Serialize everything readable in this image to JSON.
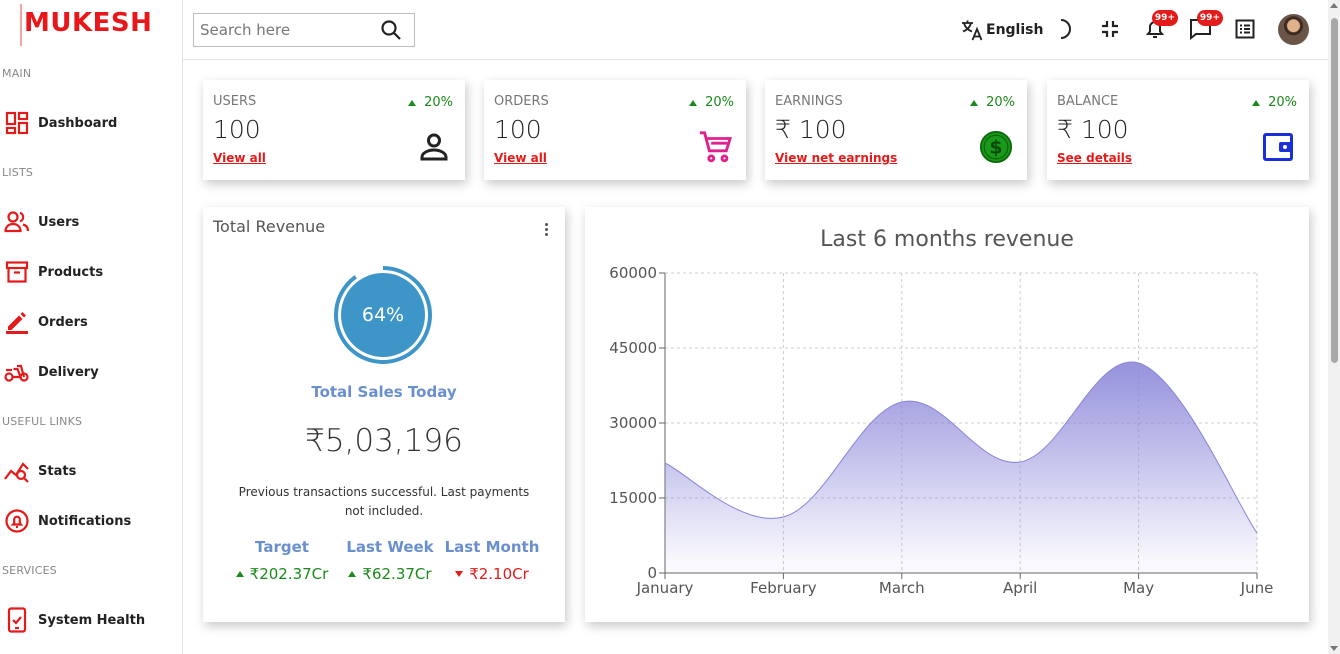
{
  "app": {
    "logo": "MUKESH"
  },
  "sidebar": {
    "sections": [
      {
        "title": "MAIN",
        "items": [
          {
            "label": "Dashboard",
            "icon": "dashboard-icon"
          }
        ]
      },
      {
        "title": "LISTS",
        "items": [
          {
            "label": "Users",
            "icon": "users-icon"
          },
          {
            "label": "Products",
            "icon": "products-icon"
          },
          {
            "label": "Orders",
            "icon": "orders-icon"
          },
          {
            "label": "Delivery",
            "icon": "delivery-icon"
          }
        ]
      },
      {
        "title": "USEFUL LINKS",
        "items": [
          {
            "label": "Stats",
            "icon": "stats-icon"
          },
          {
            "label": "Notifications",
            "icon": "notifications-icon"
          }
        ]
      },
      {
        "title": "SERVICES",
        "items": [
          {
            "label": "System Health",
            "icon": "system-health-icon"
          }
        ]
      }
    ]
  },
  "topbar": {
    "search_placeholder": "Search here",
    "language": "English",
    "notification_badge": "99+",
    "messages_badge": "99+"
  },
  "widgets": [
    {
      "title": "USERS",
      "value": "100",
      "link": "View all",
      "percent": "20%",
      "icon": "user-icon",
      "icon_color": "#222222"
    },
    {
      "title": "ORDERS",
      "value": "100",
      "link": "View all",
      "percent": "20%",
      "icon": "cart-icon",
      "icon_color": "#e0208f"
    },
    {
      "title": "EARNINGS",
      "value": "₹ 100",
      "link": "View net earnings",
      "percent": "20%",
      "icon": "dollar-icon",
      "icon_color": "#1a8a1a"
    },
    {
      "title": "BALANCE",
      "value": "₹ 100",
      "link": "See details",
      "percent": "20%",
      "icon": "wallet-icon",
      "icon_color": "#1a2fd6"
    }
  ],
  "revenue": {
    "title": "Total Revenue",
    "progress_percent": 64,
    "progress_label": "64%",
    "sales_label": "Total Sales Today",
    "amount": "₹5,03,196",
    "note": "Previous transactions successful. Last payments not included.",
    "kpis": [
      {
        "label": "Target",
        "value": "₹202.37Cr",
        "trend": "up"
      },
      {
        "label": "Last Week",
        "value": "₹62.37Cr",
        "trend": "up"
      },
      {
        "label": "Last Month",
        "value": "₹2.10Cr",
        "trend": "down"
      }
    ]
  },
  "chart_data": {
    "type": "area",
    "title": "Last 6 months revenue",
    "categories": [
      "January",
      "February",
      "March",
      "April",
      "May",
      "June"
    ],
    "values": [
      22000,
      11200,
      34200,
      22200,
      42000,
      8000
    ],
    "ylim": [
      0,
      60000
    ],
    "yticks": [
      "0",
      "15000",
      "30000",
      "45000",
      "60000"
    ],
    "grid": true,
    "fill_color": "#8884d8"
  },
  "colors": {
    "accent": "#e41b1b",
    "up": "#1a8a1a",
    "down": "#e41b1b",
    "link_blue": "#6a8fcf",
    "ring": "#3e95c8"
  }
}
